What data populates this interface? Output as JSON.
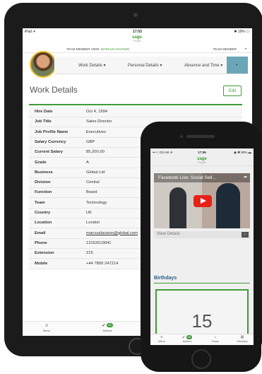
{
  "tablet": {
    "status": {
      "left": "iPad ✈",
      "time": "17:03",
      "right": "✱ 19% ▭"
    },
    "logo": {
      "mark": "sage",
      "sub": "People"
    },
    "team_member_view": {
      "label": "TEAM MEMBER VIEW:",
      "name": "MARCUS DAVISON"
    },
    "team_member_dropdown": "TEAM MEMBER",
    "nav": {
      "tabs": [
        "Work Details",
        "Personal Details",
        "Absence and Time"
      ],
      "caret": "▾"
    },
    "page_title": "Work Details",
    "edit_label": "Edit",
    "details": [
      {
        "label": "Hire Date",
        "value": "Oct 4, 1994"
      },
      {
        "label": "Job Title",
        "value": "Sales Director"
      },
      {
        "label": "Job Profile Name",
        "value": "Executives"
      },
      {
        "label": "Salary Currency",
        "value": "GBP"
      },
      {
        "label": "Current Salary",
        "value": "85,200.00"
      },
      {
        "label": "Grade",
        "value": "A"
      },
      {
        "label": "Business",
        "value": "Global Ltd"
      },
      {
        "label": "Division",
        "value": "Central"
      },
      {
        "label": "Function",
        "value": "Board"
      },
      {
        "label": "Team",
        "value": "Technology"
      },
      {
        "label": "Country",
        "value": "UK"
      },
      {
        "label": "Location",
        "value": "London"
      },
      {
        "label": "Email",
        "value": "marcusdavison@global.com"
      },
      {
        "label": "Phone",
        "value": "13152519041"
      },
      {
        "label": "Extension",
        "value": "215"
      },
      {
        "label": "Mobile",
        "value": "+44 7800 247214"
      }
    ],
    "tabbar": {
      "menu_label": "Menu",
      "actions_label": "Actions",
      "actions_badge": "26"
    }
  },
  "phone": {
    "status": {
      "carrier": "••○○ O2-UK ✈",
      "time": "17:06",
      "right": "◉ ✱ 90% ▬"
    },
    "logo": {
      "mark": "sage",
      "sub": "People"
    },
    "video": {
      "title": "Facebook Live: Social Sell..."
    },
    "view_details_label": "View Details",
    "birthdays_title": "Birthdays",
    "birthdays_count": "15",
    "tabbar": {
      "menu_label": "Menu",
      "actions_label": "Actions",
      "actions_badge": "26",
      "home_label": "Home",
      "directory_label": "Directory"
    }
  },
  "colors": {
    "brand_green": "#3f9c35",
    "nav_accent": "#6ba6b8",
    "heading_blue": "#2a5b85"
  },
  "icons": [
    "menu-icon",
    "check-icon",
    "home-icon",
    "directory-icon",
    "chevron-right-icon",
    "play-icon",
    "share-icon"
  ]
}
